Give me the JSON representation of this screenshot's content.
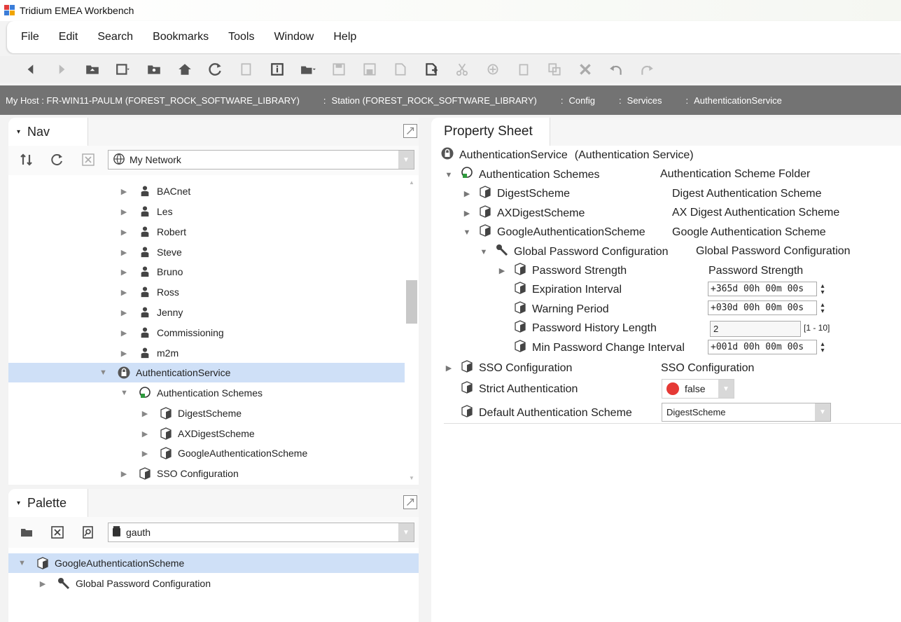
{
  "window": {
    "title": "Tridium EMEA Workbench"
  },
  "menu": [
    "File",
    "Edit",
    "Search",
    "Bookmarks",
    "Tools",
    "Window",
    "Help"
  ],
  "breadcrumb": {
    "host": "My Host : FR-WIN11-PAULM (FOREST_ROCK_SOFTWARE_LIBRARY)",
    "station": "Station (FOREST_ROCK_SOFTWARE_LIBRARY)",
    "config": "Config",
    "services": "Services",
    "service": "AuthenticationService",
    "separator": ":"
  },
  "nav": {
    "tab_label": "Nav",
    "root_selector": "My Network",
    "users": [
      "BACnet",
      "Les",
      "Robert",
      "Steve",
      "Bruno",
      "Ross",
      "Jenny",
      "Commissioning",
      "m2m"
    ],
    "auth_service": "AuthenticationService",
    "auth_schemes": "Authentication Schemes",
    "schemes": [
      "DigestScheme",
      "AXDigestScheme",
      "GoogleAuthenticationScheme"
    ],
    "sso": "SSO Configuration"
  },
  "palette": {
    "tab_label": "Palette",
    "module": "gauth",
    "tree": {
      "root": "GoogleAuthenticationScheme",
      "child": "Global Password Configuration"
    }
  },
  "property_sheet": {
    "tab_label": "Property Sheet",
    "header_name": "AuthenticationService",
    "header_type": "(Authentication Service)",
    "rows": {
      "schemes": {
        "name": "Authentication Schemes",
        "value": "Authentication Scheme Folder"
      },
      "digest": {
        "name": "DigestScheme",
        "value": "Digest Authentication Scheme"
      },
      "axdigest": {
        "name": "AXDigestScheme",
        "value": "AX Digest Authentication Scheme"
      },
      "google": {
        "name": "GoogleAuthenticationScheme",
        "value": "Google Authentication Scheme"
      },
      "global_pw": {
        "name": "Global Password Configuration",
        "value": "Global Password Configuration"
      },
      "pw_strength": {
        "name": "Password Strength",
        "value": "Password Strength"
      },
      "expiration": {
        "name": "Expiration Interval",
        "value": "+365d 00h 00m 00s"
      },
      "warning": {
        "name": "Warning Period",
        "value": "+030d 00h 00m 00s"
      },
      "history": {
        "name": "Password History Length",
        "value": "2",
        "range": "[1 - 10]"
      },
      "min_change": {
        "name": "Min Password Change Interval",
        "value": "+001d 00h 00m 00s"
      },
      "sso": {
        "name": "SSO Configuration",
        "value": "SSO Configuration"
      },
      "strict": {
        "name": "Strict Authentication",
        "value": "false"
      },
      "default_scheme": {
        "name": "Default Authentication Scheme",
        "value": "DigestScheme"
      }
    }
  },
  "colors": {
    "breadcrumb_bg": "#737373",
    "selection": "#cfe0f7",
    "false_indicator": "#e53935"
  }
}
